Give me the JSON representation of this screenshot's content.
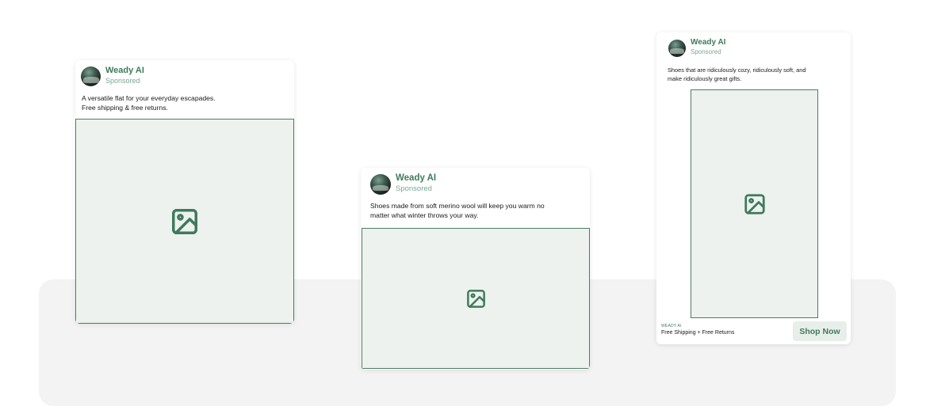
{
  "ads": [
    {
      "brand": "Weady AI",
      "sponsored": "Sponsored",
      "copy_line1": "A versatile flat for your everyday escapades.",
      "copy_line2": "Free shipping & free returns."
    },
    {
      "brand": "Weady AI",
      "sponsored": "Sponsored",
      "copy_line1": "Shoes made from soft merino wool will keep you warm no",
      "copy_line2": "matter what winter throws your way."
    },
    {
      "brand": "Weady AI",
      "sponsored": "Sponsored",
      "copy_line1": "Shoes that are ridiculously cozy, ridiculously soft, and",
      "copy_line2": "make ridiculously great gifts.",
      "footer_brand": "WEADY AI",
      "footer_offer": "Free Shipping + Free Returns",
      "cta_label": "Shop Now"
    }
  ],
  "icons": {
    "avatar": "avatar",
    "image_placeholder": "image-icon"
  },
  "colors": {
    "accent": "#3f7a5c",
    "placeholder_fill": "#edf2ee",
    "placeholder_border": "#4c7c63",
    "cta_bg": "#e8efea",
    "backdrop": "#f3f3f3"
  }
}
